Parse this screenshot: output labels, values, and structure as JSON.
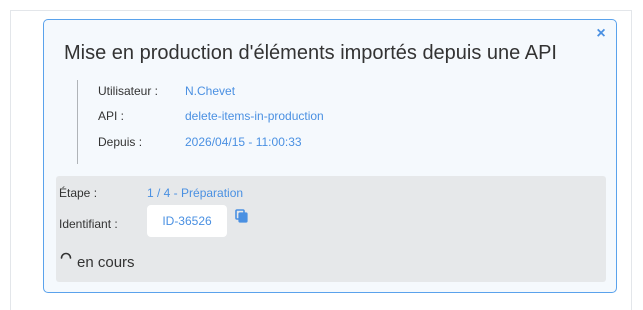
{
  "task": {
    "title": "Mise en production d'éléments importés depuis une API",
    "close_glyph": "×",
    "meta": {
      "user_label": "Utilisateur :",
      "user_value": "N.Chevet",
      "api_label": "API :",
      "api_value": "delete-items-in-production",
      "since_label": "Depuis :",
      "since_value": "2026/04/15 - 11:00:33"
    },
    "details": {
      "step_label": "Étape :",
      "step_value": "1 / 4 - Préparation",
      "id_label": "Identifiant :",
      "id_value": "ID-36526",
      "status_text": "en cours"
    }
  },
  "colors": {
    "accent": "#4a90e2",
    "card_border": "#5aa2ec",
    "card_bg": "#f5f9fd",
    "details_bg": "#e6e8ea"
  },
  "icons": {
    "close": "close-icon",
    "copy": "copy-icon",
    "spinner": "spinner-icon"
  }
}
